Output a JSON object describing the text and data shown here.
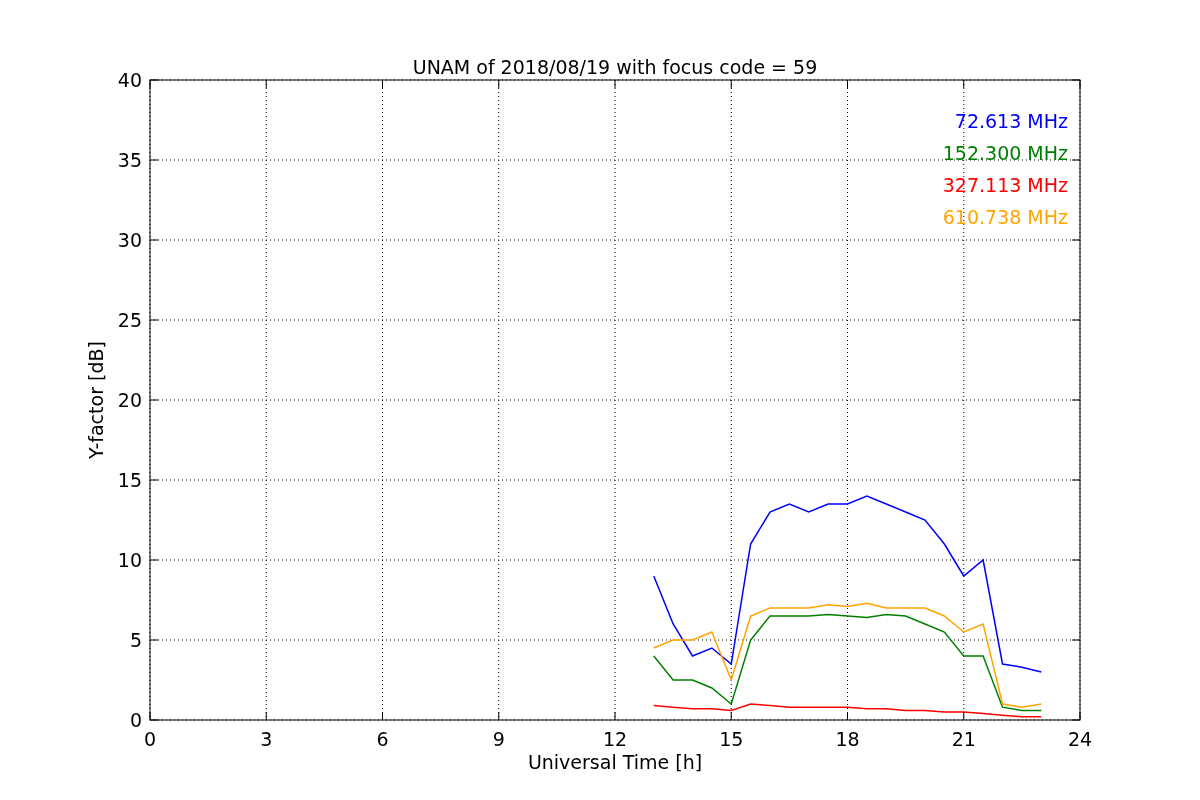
{
  "figure": {
    "chart_data": {
      "type": "line",
      "title": "UNAM of 2018/08/19 with focus code = 59",
      "xlabel": "Universal Time [h]",
      "ylabel": "Y-factor [dB]",
      "x": [
        13,
        13.5,
        14,
        14.5,
        15,
        15.5,
        16,
        16.5,
        17,
        17.5,
        18,
        18.5,
        19,
        19.5,
        20,
        20.5,
        21,
        21.5,
        22,
        22.5,
        23
      ],
      "grid": true,
      "xlim": [
        0,
        24
      ],
      "ylim": [
        0,
        40
      ],
      "xticks": [
        0,
        3,
        6,
        9,
        12,
        15,
        18,
        21,
        24
      ],
      "yticks": [
        0,
        5,
        10,
        15,
        20,
        25,
        30,
        35,
        40
      ],
      "series": [
        {
          "name": "72.613 MHz",
          "color": "#0000ff",
          "values": [
            9,
            6,
            4,
            4.5,
            3.5,
            11,
            13,
            13.5,
            13,
            13.5,
            13.5,
            14,
            13.5,
            13,
            12.5,
            11,
            9,
            10,
            3.5,
            3.3,
            3
          ]
        },
        {
          "name": "152.300 MHz",
          "color": "#008000",
          "values": [
            4,
            2.5,
            2.5,
            2,
            1,
            5,
            6.5,
            6.5,
            6.5,
            6.6,
            6.5,
            6.4,
            6.6,
            6.5,
            6,
            5.5,
            4,
            4,
            0.8,
            0.6,
            0.6
          ]
        },
        {
          "name": "327.113 MHz",
          "color": "#ff0000",
          "values": [
            0.9,
            0.8,
            0.7,
            0.7,
            0.6,
            1,
            0.9,
            0.8,
            0.8,
            0.8,
            0.8,
            0.7,
            0.7,
            0.6,
            0.6,
            0.5,
            0.5,
            0.4,
            0.3,
            0.2,
            0.2
          ]
        },
        {
          "name": "610.738 MHz",
          "color": "#ffa500",
          "values": [
            4.5,
            5,
            5,
            5.5,
            2.5,
            6.5,
            7,
            7,
            7,
            7.2,
            7.1,
            7.3,
            7,
            7,
            7,
            6.5,
            5.5,
            6,
            1,
            0.8,
            1
          ]
        }
      ]
    }
  }
}
